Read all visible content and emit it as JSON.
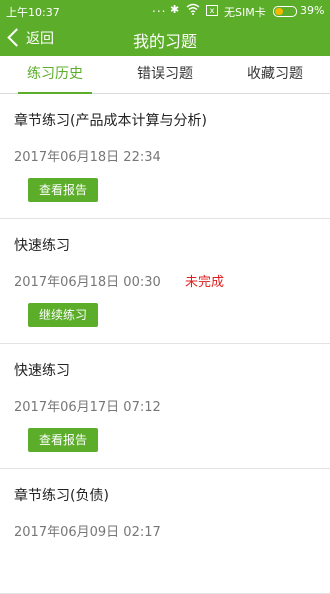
{
  "status_bar": {
    "time": "上午10:37",
    "dots": "...",
    "bluetooth": "✱",
    "nosim_icon": "x",
    "sim": "无SIM卡",
    "battery_percent": "39%",
    "battery_level": 0.39,
    "battery_color": "#f5b800"
  },
  "header": {
    "back_label": "返回",
    "title": "我的习题",
    "bg_color": "#5cad2a"
  },
  "tabs": [
    {
      "label": "练习历史",
      "active": true
    },
    {
      "label": "错误习题",
      "active": false
    },
    {
      "label": "收藏习题",
      "active": false
    }
  ],
  "records": [
    {
      "title": "章节练习(产品成本计算与分析)",
      "time": "2017年06月18日  22:34",
      "status": "",
      "button": "查看报告"
    },
    {
      "title": "快速练习",
      "time": "2017年06月18日  00:30",
      "status": "未完成",
      "button": "继续练习"
    },
    {
      "title": "快速练习",
      "time": "2017年06月17日  07:12",
      "status": "",
      "button": "查看报告"
    },
    {
      "title": "章节练习(负债)",
      "time": "2017年06月09日  02:17",
      "status": "",
      "button": ""
    }
  ]
}
